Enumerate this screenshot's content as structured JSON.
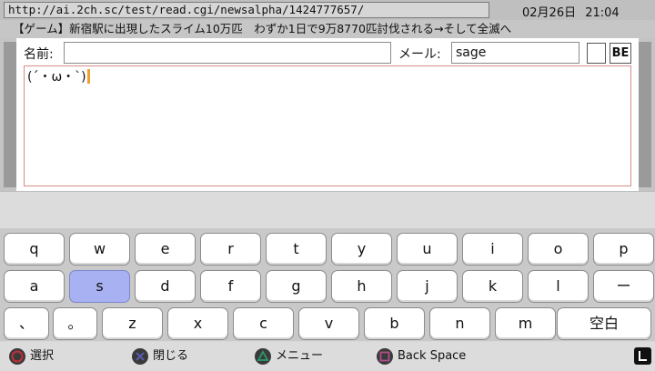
{
  "topbar": {
    "url": "http://ai.2ch.sc/test/read.cgi/newsalpha/1424777657/",
    "date": "02月26日",
    "time": "21:04"
  },
  "thread_title": "【ゲーム】新宿駅に出現したスライム10万匹　わずか1日で9万8770匹討伐される→そして全滅へ",
  "form": {
    "name_label": "名前:",
    "name_value": "",
    "mail_label": "メール:",
    "mail_value": "sage",
    "be_label": "BE",
    "body_text": "(´・ω・`)"
  },
  "keyboard": {
    "rows": [
      [
        "q",
        "w",
        "e",
        "r",
        "t",
        "y",
        "u",
        "i",
        "o",
        "p"
      ],
      [
        "a",
        "s",
        "d",
        "f",
        "g",
        "h",
        "j",
        "k",
        "l",
        "ー"
      ],
      [
        "、",
        "。",
        "z",
        "x",
        "c",
        "v",
        "b",
        "n",
        "m",
        "空白"
      ]
    ],
    "selected_key": "s"
  },
  "bottombar": {
    "hints": [
      {
        "icon": "circle-button-icon",
        "label": "選択"
      },
      {
        "icon": "cross-button-icon",
        "label": "閉じる"
      },
      {
        "icon": "triangle-button-icon",
        "label": "メニュー"
      },
      {
        "icon": "square-button-icon",
        "label": "Back Space"
      }
    ],
    "l_button_icon": "l-shoulder-button-icon"
  },
  "colors": {
    "selected_key": "#a8b2f2",
    "caret": "#f0a030",
    "circle": "#c0303a",
    "cross": "#5a5ab0",
    "triangle": "#2a9a6a",
    "square": "#b0508a"
  }
}
